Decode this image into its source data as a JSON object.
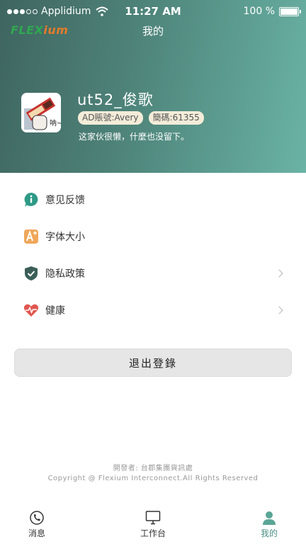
{
  "status_bar": {
    "carrier": "Applidium",
    "time": "11:27 AM",
    "battery": "100 %"
  },
  "header": {
    "logo_part1": "FLEX",
    "logo_part2": "ium",
    "title": "我的",
    "username": "ut52_俊歌",
    "tag_ad": "AD賬號:Avery",
    "tag_code": "簡碼:61355",
    "bio": "这家伙很懒，什麼也没留下。",
    "avatar_caption": "呐~"
  },
  "menu": {
    "items": [
      {
        "label": "意见反馈",
        "icon": "feedback-icon",
        "chevron": false
      },
      {
        "label": "字体大小",
        "icon": "font-size-icon",
        "chevron": false
      },
      {
        "label": "隐私政策",
        "icon": "shield-icon",
        "chevron": true
      },
      {
        "label": "健康",
        "icon": "heart-pulse-icon",
        "chevron": true
      }
    ]
  },
  "logout_label": "退出登錄",
  "footer": {
    "developer": "開發者: 台郡集團資訊處",
    "copyright": "Copyright @ Flexium Interconnect.All Rights Reserved"
  },
  "tabbar": {
    "tabs": [
      {
        "label": "消息",
        "icon": "chat-icon"
      },
      {
        "label": "工作台",
        "icon": "monitor-icon"
      },
      {
        "label": "我的",
        "icon": "person-icon"
      }
    ],
    "active_index": 2
  },
  "colors": {
    "accent": "#4a8f84",
    "header_start": "#3f6560",
    "header_end": "#6ab3a5",
    "tag_bg": "#f3ecd9"
  }
}
